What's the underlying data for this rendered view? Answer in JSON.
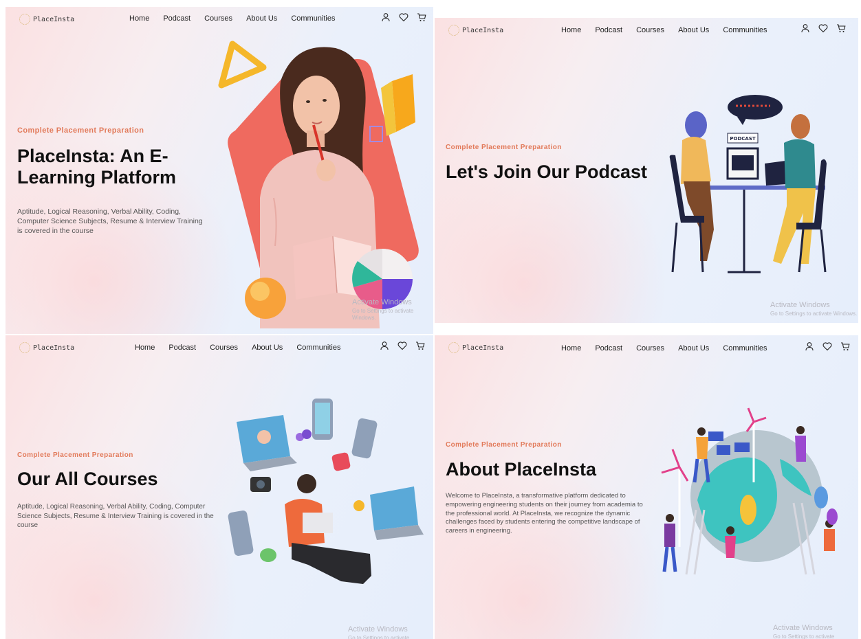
{
  "nav": {
    "logo": "PlaceInsta",
    "links": [
      "Home",
      "Podcast",
      "Courses",
      "About Us",
      "Communities"
    ]
  },
  "icons": [
    "user-icon",
    "heart-icon",
    "cart-icon"
  ],
  "watermark": {
    "title": "Activate Windows",
    "subtitle": "Go to Settings to activate Windows."
  },
  "panels": {
    "home": {
      "tagline": "Complete Placement Preparation",
      "headline": [
        "PlaceInsta: An E-",
        "Learning Platform"
      ],
      "description": "Aptitude, Logical Reasoning, Verbal Ability, Coding, Computer Science Subjects, Resume & Interview Training is covered in the course"
    },
    "podcast": {
      "tagline": "Complete Placement Preparation",
      "headline": "Let's Join Our Podcast",
      "illustration_label": "PODCAST"
    },
    "courses": {
      "tagline": "Complete Placement Preparation",
      "headline": "Our All Courses",
      "description": "Aptitude, Logical Reasoning, Verbal Ability, Coding, Computer Science Subjects, Resume & Interview Training is covered in the course"
    },
    "about": {
      "tagline": "Complete Placement Preparation",
      "headline": "About PlaceInsta",
      "description": "Welcome to PlaceInsta, a transformative platform dedicated to empowering engineering students on their journey from academia to the professional world. At PlaceInsta, we recognize the dynamic challenges faced by students entering the competitive landscape of careers in engineering."
    }
  },
  "colors": {
    "accent": "#e27a5a",
    "coral": "#ef6a5f",
    "headline": "#111111"
  }
}
